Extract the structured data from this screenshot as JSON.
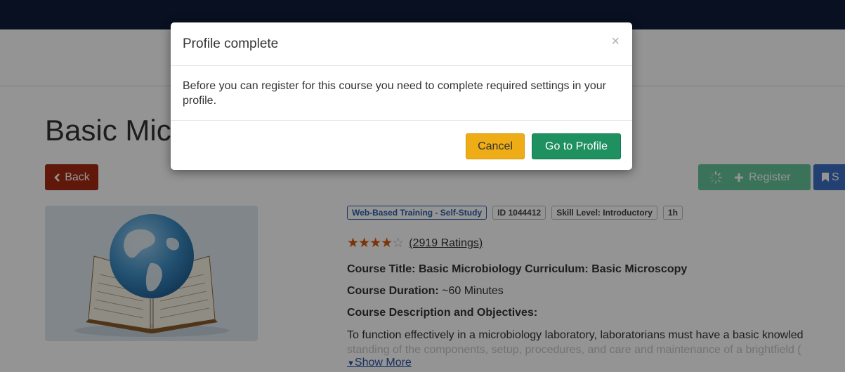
{
  "course": {
    "title": "Basic Microbiology Curriculum",
    "back_label": "Back",
    "register_label": "Register",
    "save_label": "S",
    "badges": [
      "Web-Based Training - Self-Study",
      "ID 1044412",
      "Skill Level: Introductory",
      "1h"
    ],
    "rating": {
      "value": 4,
      "max": 5,
      "text": "(2919 Ratings)"
    },
    "course_title_label": "Course Title: Basic Microbiology Curriculum: Basic Microscopy",
    "duration_label": "Course Duration:",
    "duration_value": " ~60 Minutes",
    "description_label": "Course Description and Objectives:",
    "description_line1": "To function effectively in a microbiology laboratory, laboratorians must have a basic knowled",
    "description_line2": "standing of the components, setup, procedures, and care and maintenance of a brightfield (",
    "show_more_label": "Show More"
  },
  "modal": {
    "title": "Profile complete",
    "close_label": "×",
    "body": "Before you can register for this course you need to complete required settings in your profile.",
    "cancel_label": "Cancel",
    "profile_label": "Go to Profile"
  },
  "icons": {
    "back": "chevron-left-icon",
    "spinner": "spinner-icon",
    "register": "plus-icon",
    "save": "bookmark-icon",
    "close": "close-icon",
    "thumbnail": "globe-book-icon"
  },
  "colors": {
    "topbar": "#0f1c3a",
    "back_button": "#a52a12",
    "register_button": "#66c59b",
    "save_button": "#3b6fc4",
    "cancel_button": "#eeac16",
    "profile_button": "#1f9060",
    "stars": "#d65a10"
  }
}
